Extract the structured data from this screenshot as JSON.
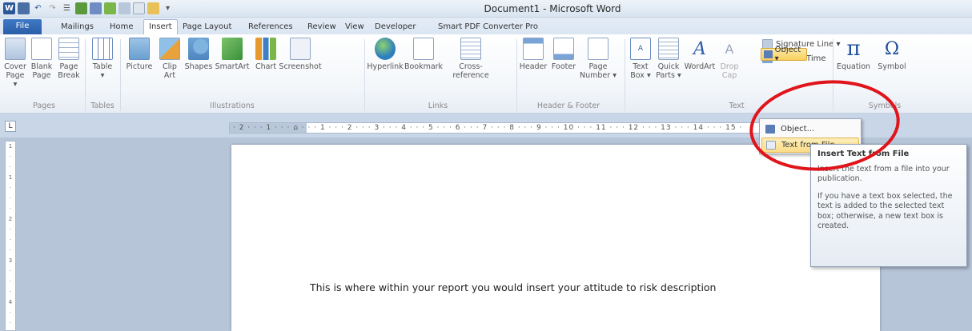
{
  "window": {
    "title": "Document1  -  Microsoft Word"
  },
  "tabs": [
    "File",
    "Mailings",
    "Home",
    "Insert",
    "Page Layout",
    "References",
    "Review",
    "View",
    "Developer",
    "Smart PDF Converter Pro"
  ],
  "active_tab": "Insert",
  "ribbon": {
    "pages": {
      "group": "Pages",
      "cover": [
        "Cover",
        "Page ▾"
      ],
      "blank": [
        "Blank",
        "Page"
      ],
      "break": [
        "Page",
        "Break"
      ]
    },
    "tables": {
      "group": "Tables",
      "table": [
        "Table",
        "▾"
      ]
    },
    "illustrations": {
      "group": "Illustrations",
      "picture": "Picture",
      "clipart": [
        "Clip",
        "Art"
      ],
      "shapes": "Shapes",
      "smartart": "SmartArt",
      "chart": "Chart",
      "screenshot": "Screenshot"
    },
    "links": {
      "group": "Links",
      "hyperlink": "Hyperlink",
      "bookmark": "Bookmark",
      "crossref": "Cross-reference"
    },
    "header_footer": {
      "group": "Header & Footer",
      "header": "Header",
      "footer": "Footer",
      "pagenum": [
        "Page",
        "Number ▾"
      ]
    },
    "text": {
      "group": "Text",
      "textbox": [
        "Text",
        "Box ▾"
      ],
      "quickparts": [
        "Quick",
        "Parts ▾"
      ],
      "wordart": "WordArt",
      "dropcap": [
        "Drop",
        "Cap"
      ],
      "signature": "Signature Line ▾",
      "datetime": "Date & Time",
      "object": "Object ▾"
    },
    "symbols": {
      "group": "Symbols",
      "equation": "Equation",
      "symbol": "Symbol"
    }
  },
  "dropdown": {
    "items": [
      "Object...",
      "Text from File..."
    ]
  },
  "tooltip": {
    "title": "Insert Text from File",
    "p1": "Insert the text from a file into your publication.",
    "p2": "If you have a text box selected, the text is added to the selected text box; otherwise, a new text box is created."
  },
  "ruler": {
    "corner": "L",
    "marks": "· 2 · · · 1 · · · ⌂ · · · 1 · · · 2 · · · 3 · · · 4 · · · 5 · · · 6 · · · 7 · · · 8 · · · 9 · · · 10 · · · 11 · · · 12 · · · 13 · · · 14 · · · 15 ·"
  },
  "document": {
    "body": "This is where within your report you would insert your attitude to risk description"
  },
  "colors": {
    "accent": "#2a5ea8",
    "highlight": "#f8cf5c",
    "annotation": "#e0141b"
  }
}
